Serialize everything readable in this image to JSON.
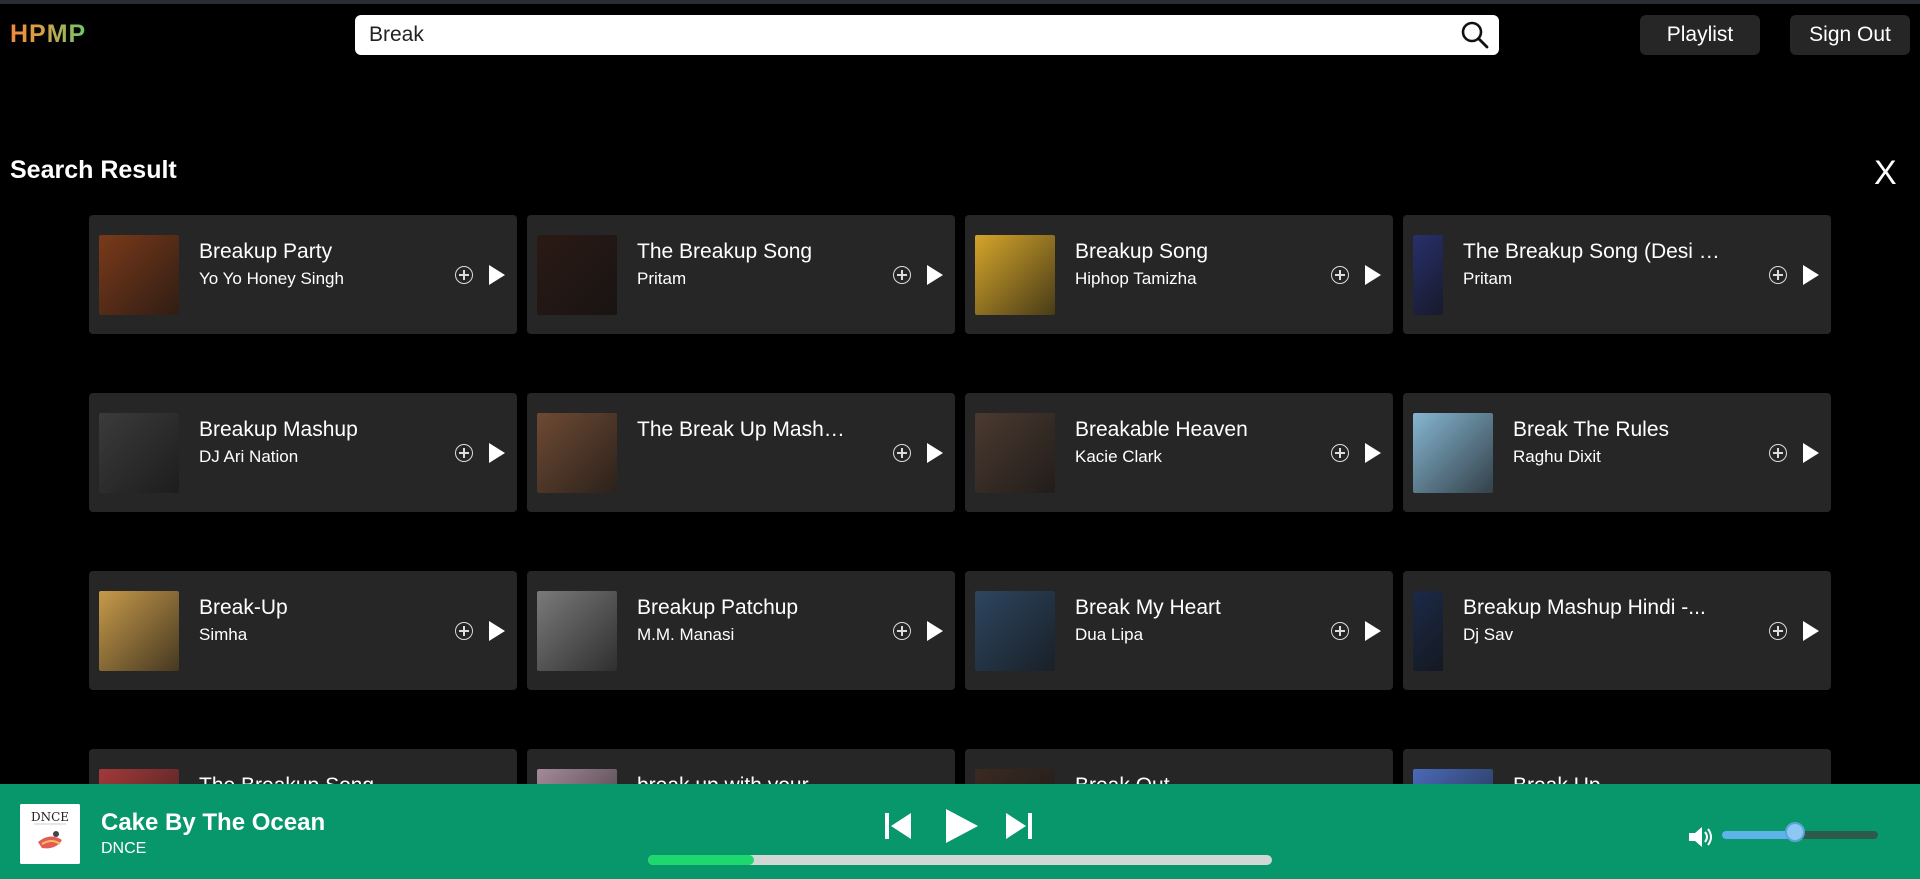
{
  "app": {
    "logo": "HPMP"
  },
  "search": {
    "value": "Break",
    "placeholder": ""
  },
  "header": {
    "playlist_label": "Playlist",
    "signout_label": "Sign Out"
  },
  "results": {
    "title": "Search Result",
    "close_label": "X",
    "items": [
      {
        "title": "Breakup Party",
        "artist": "Yo Yo Honey Singh",
        "art": "#7a3a1a"
      },
      {
        "title": "The Breakup Song",
        "artist": "Pritam",
        "art": "#2b1a15"
      },
      {
        "title": "Breakup Song",
        "artist": "Hiphop Tamizha",
        "art": "#d4a52a"
      },
      {
        "title": "The Breakup Song (Desi Mix B...",
        "artist": "Pritam",
        "art": "#27306b"
      },
      {
        "title": "Breakup Mashup",
        "artist": "DJ Ari Nation",
        "art": "#3b3b3b"
      },
      {
        "title": "The Break Up Mashup",
        "artist": "",
        "art": "#6e4a33"
      },
      {
        "title": "Breakable Heaven",
        "artist": "Kacie Clark",
        "art": "#4b3a30"
      },
      {
        "title": "Break The Rules",
        "artist": "Raghu Dixit",
        "art": "#86b6d2"
      },
      {
        "title": "Break-Up",
        "artist": "Simha",
        "art": "#c79a4a"
      },
      {
        "title": "Breakup Patchup",
        "artist": "M.M. Manasi",
        "art": "#7a7a7a"
      },
      {
        "title": "Break My Heart",
        "artist": "Dua Lipa",
        "art": "#2d4660"
      },
      {
        "title": "Breakup Mashup Hindi -...",
        "artist": "Dj Sav",
        "art": "#1c2a48"
      },
      {
        "title": "The Breakup Song",
        "artist": "",
        "art": "#a33a3a"
      },
      {
        "title": "break up with your girlfrien",
        "artist": "",
        "art": "#a48a9a"
      },
      {
        "title": "Break Out",
        "artist": "",
        "art": "#3a2a22"
      },
      {
        "title": "Break Up",
        "artist": "",
        "art": "#4a6ab8"
      }
    ]
  },
  "player": {
    "title": "Cake By The Ocean",
    "artist": "DNCE",
    "cover_text": "DNCE",
    "progress": 0.17,
    "volume": 0.47
  }
}
